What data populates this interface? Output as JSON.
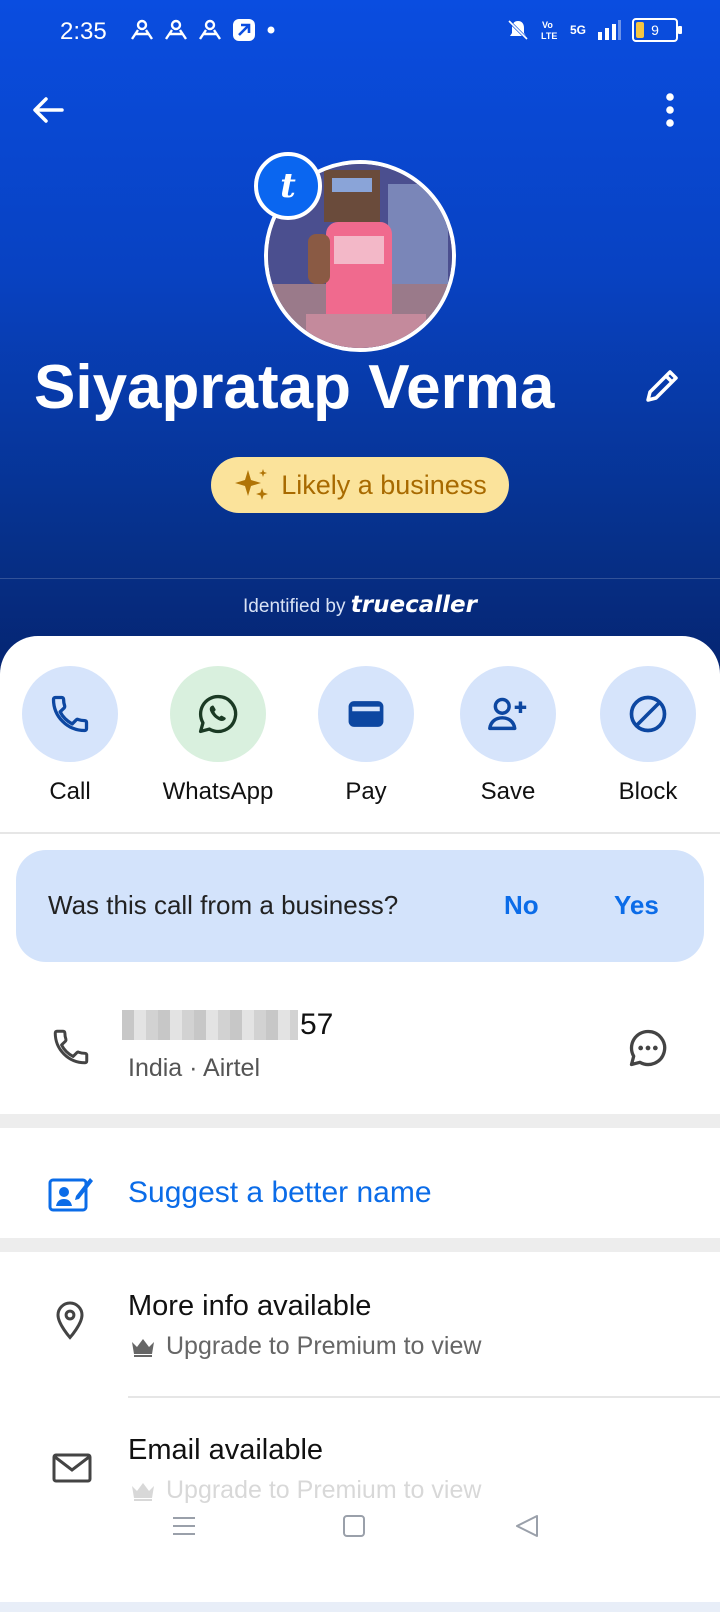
{
  "status_bar": {
    "time": "2:35",
    "battery": "9",
    "network": "5G"
  },
  "profile": {
    "name": "Siyapratap Verma",
    "badge_letter": "t",
    "business_badge": "Likely a business",
    "identified_prefix": "Identified by",
    "identified_brand": "truecaller"
  },
  "actions": [
    {
      "label": "Call",
      "icon": "phone-icon"
    },
    {
      "label": "WhatsApp",
      "icon": "whatsapp-icon"
    },
    {
      "label": "Pay",
      "icon": "wallet-icon"
    },
    {
      "label": "Save",
      "icon": "add-person-icon"
    },
    {
      "label": "Block",
      "icon": "block-icon"
    }
  ],
  "business_question": {
    "text": "Was this call from a business?",
    "no": "No",
    "yes": "Yes"
  },
  "phone": {
    "number_suffix": "57",
    "meta": "India · Airtel"
  },
  "suggest": {
    "label": "Suggest a better name"
  },
  "more_info": {
    "title": "More info available",
    "subtitle": "Upgrade to Premium to view"
  },
  "email": {
    "title": "Email available",
    "subtitle": "Upgrade to Premium to view"
  },
  "colors": {
    "header_blue": "#0a4de0",
    "accent_blue": "#0b6ce8",
    "business_badge_bg": "#fbe39b",
    "business_badge_text": "#a86a00"
  }
}
